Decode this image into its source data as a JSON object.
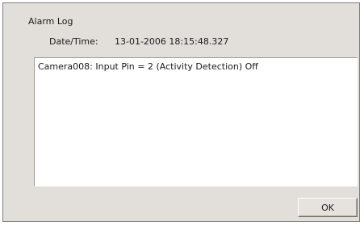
{
  "dialog": {
    "title": "Alarm Log",
    "datetime_label": "Date/Time:",
    "datetime_value": "13-01-2006 18:15:48.327",
    "log_text": "Camera008: Input Pin = 2 (Activity Detection) Off",
    "ok_label": "OK"
  },
  "colors": {
    "dialog_background": "#e2dfdb",
    "log_background": "#ffffff"
  }
}
